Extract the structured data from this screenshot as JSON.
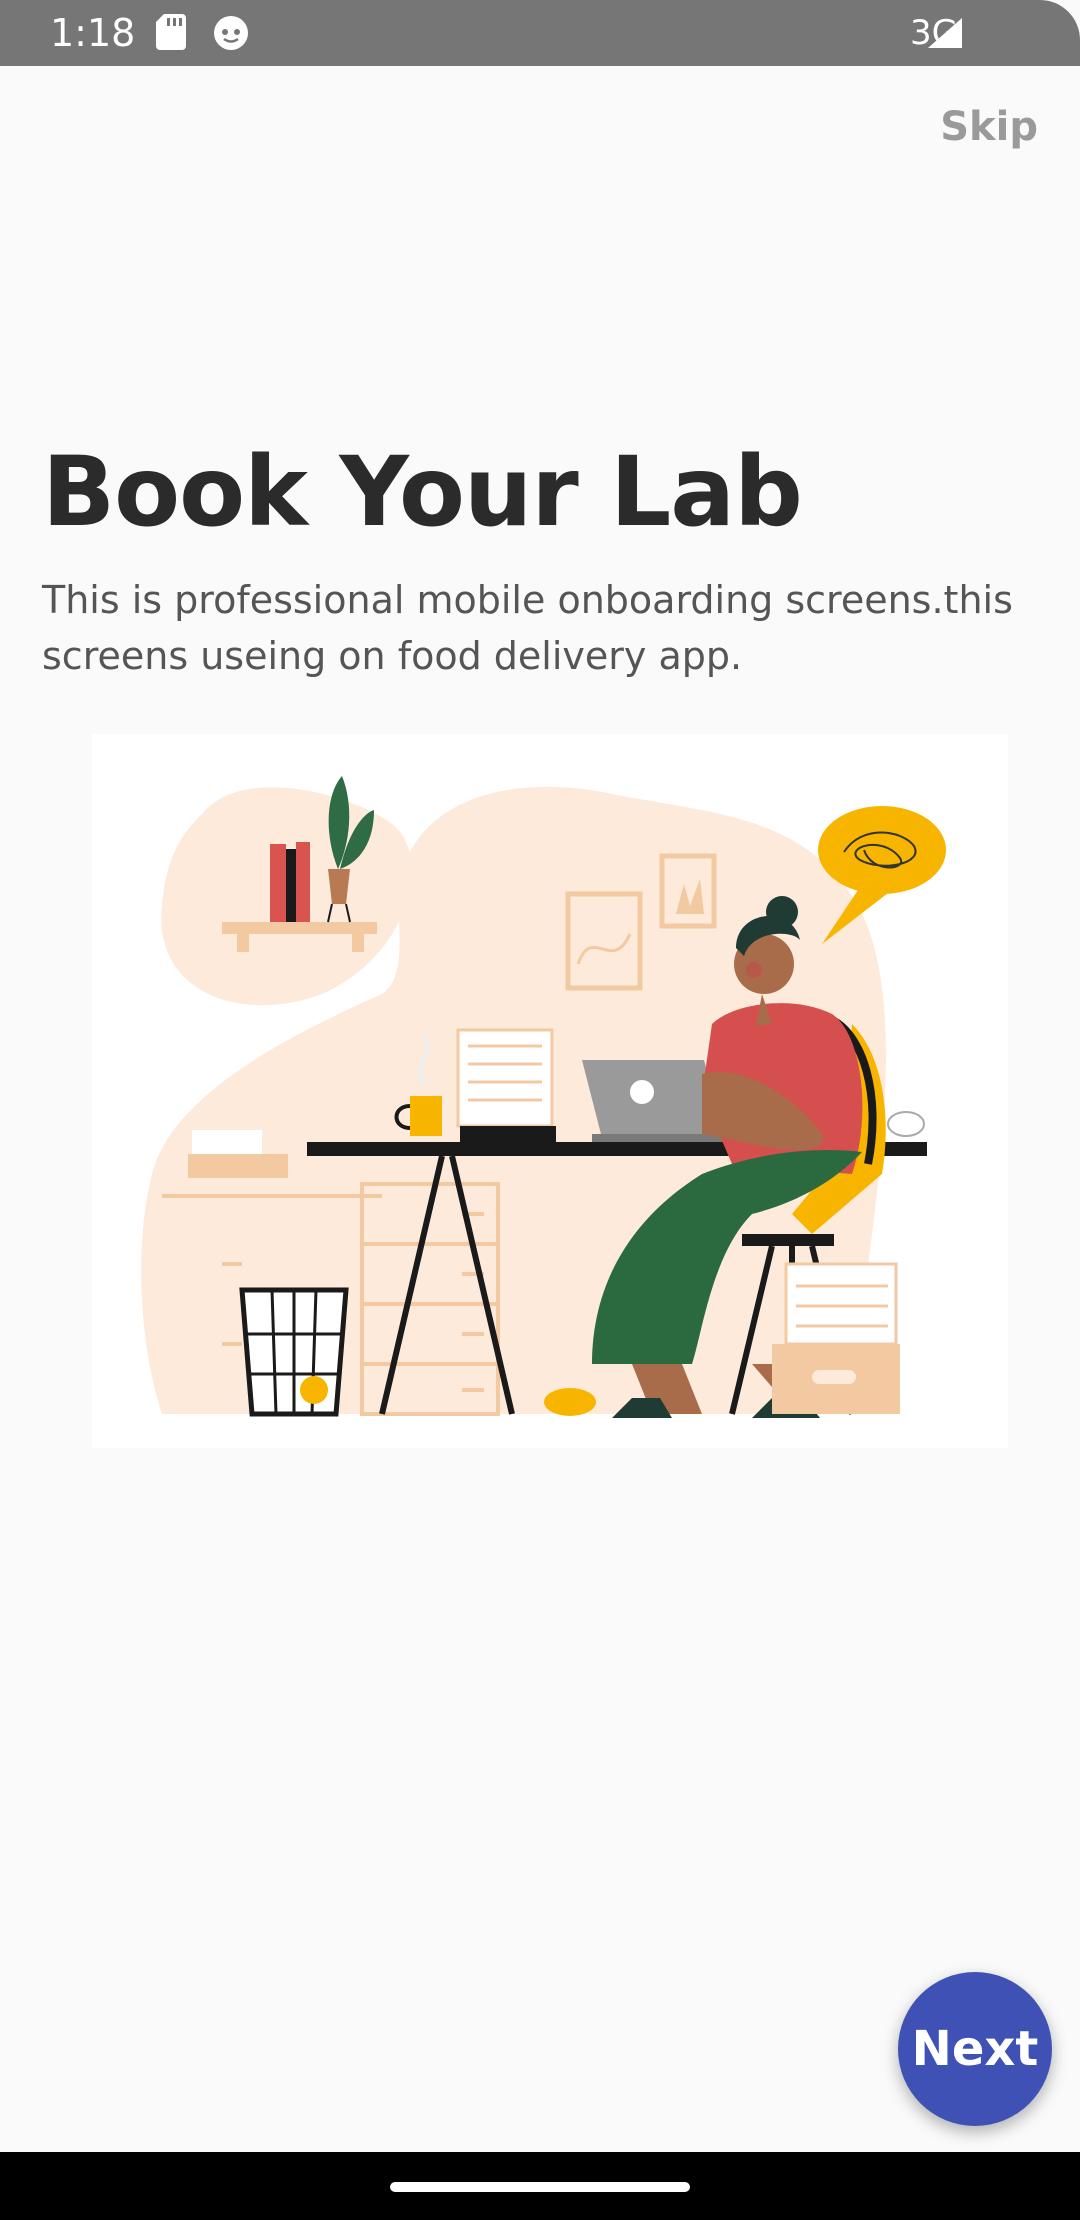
{
  "status_bar": {
    "time": "1:18",
    "network": "3G",
    "icons": [
      "sd-card-icon",
      "notification-icon",
      "signal-icon"
    ]
  },
  "onboarding": {
    "skip_label": "Skip",
    "title": "Book Your Lab",
    "description": "This is professional mobile onboarding screens.this screens useing on food delivery app.",
    "next_label": "Next"
  },
  "colors": {
    "background": "#fafafa",
    "status_bar": "#767676",
    "title": "#2b2b2b",
    "description": "#555555",
    "skip": "#9a9a9a",
    "accent": "#3f51b5"
  }
}
